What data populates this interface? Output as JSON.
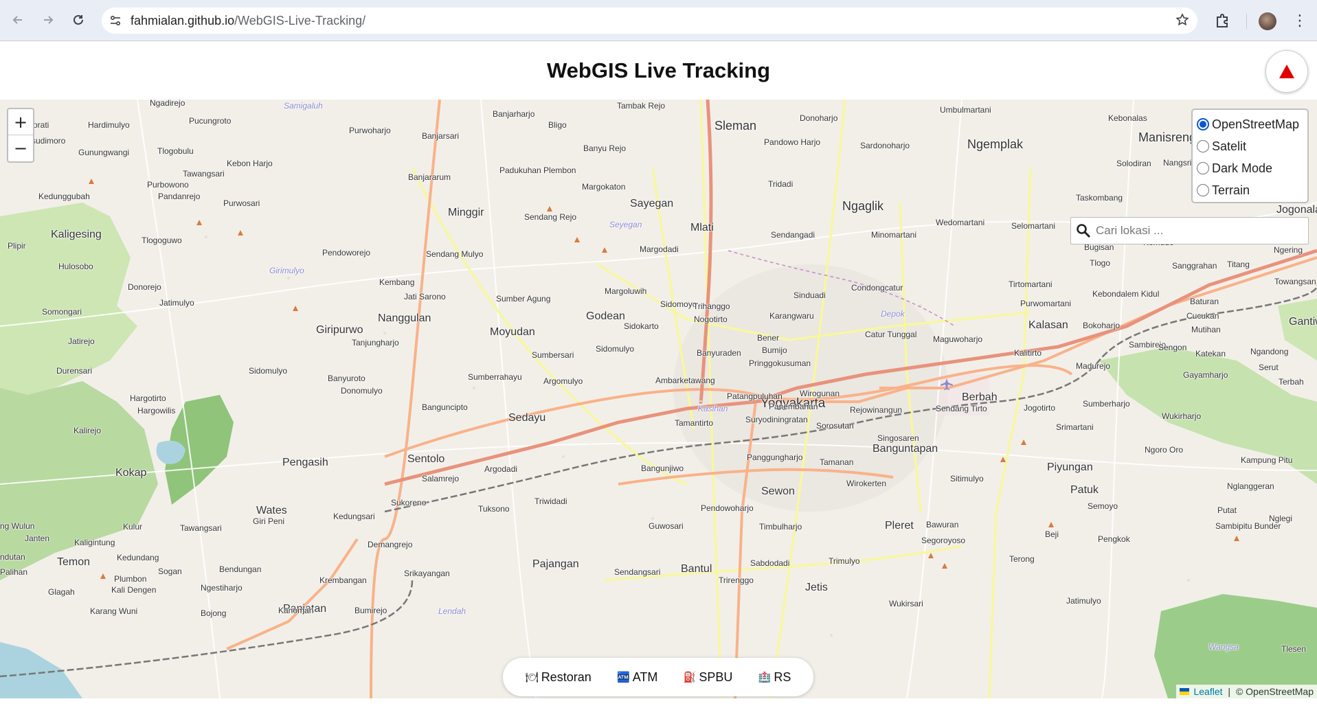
{
  "browser": {
    "url_host": "fahmialan.github.io",
    "url_path": "/WebGIS-Live-Tracking/"
  },
  "header": {
    "title": "WebGIS Live Tracking"
  },
  "map": {
    "zoom_in_label": "+",
    "zoom_out_label": "−",
    "layers": [
      {
        "label": "OpenStreetMap",
        "selected": true
      },
      {
        "label": "Satelit",
        "selected": false
      },
      {
        "label": "Dark Mode",
        "selected": false
      },
      {
        "label": "Terrain",
        "selected": false
      }
    ],
    "search": {
      "placeholder": "Cari lokasi ..."
    },
    "poi_filters": [
      {
        "emoji": "🍽",
        "label": "Restoran"
      },
      {
        "emoji": "🏧",
        "label": "ATM"
      },
      {
        "emoji": "⛽",
        "label": "SPBU"
      },
      {
        "emoji": "🏥",
        "label": "RS"
      }
    ],
    "attribution": {
      "leaflet": "Leaflet",
      "separator": " | ",
      "osm": "© OpenStreetMap"
    },
    "places": {
      "yogyakarta": "Yogyakarta",
      "sleman": "Sleman",
      "ngemplak": "Ngemplak",
      "manisrenggo": "Manisrenggo",
      "sayegan": "Sayegan",
      "mlati": "Mlati",
      "ngaglik": "Ngaglik",
      "minggir": "Minggir",
      "godean": "Godean",
      "moyudan": "Moyudan",
      "nanggulan": "Nanggulan",
      "giripurwo": "Giripurwo",
      "kaligesing": "Kaligesing",
      "kalasan": "Kalasan",
      "gantiwarno": "Gantiwar",
      "berbah": "Berbah",
      "sedayu": "Sedayu",
      "sentolo": "Sentolo",
      "pengasih": "Pengasih",
      "kokap": "Kokap",
      "wates": "Wates",
      "temon": "Temon",
      "panjatan": "Panjatan",
      "pajangan": "Pajangan",
      "bantul": "Bantul",
      "jetis": "Jetis",
      "sewon": "Sewon",
      "banguntapan": "Banguntapan",
      "pleret": "Pleret",
      "piyungan": "Piyungan",
      "patuk": "Patuk",
      "jogonalan": "Jogonalan",
      "donoharjo": "Donoharjo",
      "umbulmartani": "Umbulmartani",
      "kebonalas": "Kebonalas",
      "hardimulyo": "Hardimulyo",
      "pucungroto": "Pucungroto",
      "banjarharjo": "Banjarharjo",
      "tambak_rejo": "Tambak Rejo",
      "samigaluh": "Samigaluh",
      "ngadirejo": "Ngadirejo",
      "purwoharjo": "Purwoharjo",
      "bligo": "Bligo",
      "banyu_rejo": "Banyu Rejo",
      "pandowo_harjo": "Pandowo Harjo",
      "sardonoharjo": "Sardonoharjo",
      "gunungwangi": "Gunungwangi",
      "tlogobulu": "Tlogobulu",
      "kebon_harjo": "Kebon Harjo",
      "banjarsari": "Banjarsari",
      "banjararum": "Banjararum",
      "padukuhan_plembon": "Padukuhan Plembon",
      "margokaton": "Margokaton",
      "tridadi": "Tridadi",
      "kedunggubah": "Kedunggubah",
      "pandanrejo": "Pandanrejo",
      "purwosari": "Purwosari",
      "sendang_rejo": "Sendang Rejo",
      "seyegan": "Seyegan",
      "sendangadi": "Sendangadi",
      "minomartani": "Minomartani",
      "wedomartani": "Wedomartani",
      "selomartani": "Selomartani",
      "taskombang": "Taskombang",
      "tlogoguwo": "Tlogoguwo",
      "pendoworejo": "Pendoworejo",
      "sendang_mulyo": "Sendang Mulyo",
      "margodadi": "Margodadi",
      "kembang": "Kembang",
      "jati_sarono": "Jati Sarono",
      "sumber_agung": "Sumber Agung",
      "margoluwih": "Margoluwih",
      "sinduadi": "Sinduadi",
      "condongcatur": "Condongcatur",
      "purwomartani": "Purwomartani",
      "tirtomartani": "Tirtomartani",
      "kebondalem_kidul": "Kebondalem Kidul",
      "baturan": "Baturan",
      "hulosobo": "Hulosobo",
      "donorejo": "Donorejo",
      "jatimulyo": "Jatimulyo",
      "somongari": "Somongari",
      "sidomoyo": "Sidomoyo",
      "trihanggo": "Trihanggo",
      "karangwaru": "Karangwaru",
      "depok": "Depok",
      "sidokarto": "Sidokarto",
      "nogotirto": "Nogotirto",
      "bener": "Bener",
      "catur_tunggal": "Catur Tunggal",
      "maguwoharjo": "Maguwoharjo",
      "bokoharjo": "Bokoharjo",
      "sambirejo": "Sambirejo",
      "tanjungharjo": "Tanjungharjo",
      "sumbersari": "Sumbersari",
      "sidomulyo": "Sidomulyo",
      "banyuraden": "Banyuraden",
      "bumijo": "Bumijo",
      "pringgokusuman": "Pringgokusuman",
      "kalitirto": "Kalitirto",
      "madurejo": "Madurejo",
      "gayamharjo": "Gayamharjo",
      "durensari": "Durensari",
      "banyuroto": "Banyuroto",
      "donomulyo": "Donomulyo",
      "sumberrahayu": "Sumberrahayu",
      "argomulyo": "Argomulyo",
      "ambarketawang": "Ambarketawang",
      "patangpuluhan": "Patangpuluhan",
      "wirogunan": "Wirogunan",
      "hargotirto": "Hargotirto",
      "hargowilis": "Hargowilis",
      "bangunjipto": "Banguncipto",
      "kasihan": "Kasihan",
      "panembahan": "Panembahan",
      "rejowinangun": "Rejowinangun",
      "sendang_tirto": "Sendang Tirto",
      "jogotirto": "Jogotirto",
      "sumberharjo": "Sumberharjo",
      "wukirharjo": "Wukirharjo",
      "kalirejo": "Kalirejo",
      "tamantirto": "Tamantirto",
      "suryodiningratan": "Suryodiningratan",
      "sorosutan": "Sorosutan",
      "srimartani": "Srimartani",
      "singosaren": "Singosaren",
      "argodadi": "Argodadi",
      "salamrejo": "Salamrejo",
      "bangunjiwo": "Bangunjiwo",
      "panggungharjo": "Panggungharjo",
      "tamanan": "Tamanan",
      "sitimulyo": "Sitimulyo",
      "ngoro_oro": "Ngoro Oro",
      "kampung_pitu": "Kampung Pitu",
      "triwidadi": "Triwidadi",
      "sukoreno": "Sukoreno",
      "tuksono": "Tuksono",
      "pendowoharjo": "Pendowoharjo",
      "wirokerten": "Wirokerten",
      "nglanggeran": "Nglanggeran",
      "ngwulun": "ng Wulun",
      "janten": "Janten",
      "kulur": "Kulur",
      "tawangsari": "Tawangsari",
      "giri_peni": "Giri Peni",
      "kedungsari": "Kedungsari",
      "guwosari": "Guwosari",
      "timbulharjo": "Timbulharjo",
      "bawuran": "Bawuran",
      "semoyo": "Semoyo",
      "putat": "Putat",
      "kaligintung": "Kaligintung",
      "demangrejo": "Demangrejo",
      "segoroyoso": "Segoroyoso",
      "beji": "Beji",
      "pengkok": "Pengkok",
      "sambipitu_bunder": "Sambipitu Bunder",
      "ngelegi": "Nglegi",
      "kedundang": "Kedundang",
      "sabdodadi": "Sabdodadi",
      "trimulyo": "Trimulyo",
      "terong": "Terong",
      "sogan": "Sogan",
      "bendungan": "Bendungan",
      "srikayangan": "Srikayangan",
      "sendangsari": "Sendangsari",
      "plumbon": "Plumbon",
      "kali_dengen": "Kali Dengen",
      "ngestiharjo": "Ngestiharjo",
      "krembangan": "Krembangan",
      "trirenggo": "Trirenggo",
      "glagah": "Glagah",
      "karang_wuni": "Karang Wuni",
      "bojong": "Bojong",
      "kanoman": "Kanoman",
      "bumirejo": "Bumirejo",
      "lendah": "Lendah",
      "wukirsari": "Wukirsari",
      "jatimulyo2": "Jatimulyo",
      "tlogo": "Tlogo",
      "kemudo": "Kemudo",
      "bugisan": "Bugisan",
      "sanggrahan": "Sanggrahan",
      "titang": "Titang",
      "ngering": "Ngering",
      "towangsan": "Towangsan",
      "cucukan": "Cucukan",
      "mutihan": "Mutihan",
      "sengon": "Sengon",
      "katekan": "Katekan",
      "ngandong": "Ngandong",
      "serut": "Serut",
      "terbah": "Terbah",
      "nangsri": "Nangsri",
      "solodiran": "Solodiran",
      "wangsa": "Wangsa",
      "tlesen": "Tlesen",
      "jatirejo": "Jatirejo",
      "girimulyo": "Girimulyo",
      "plipir": "Plipir",
      "tawangsari2": "Tawangsari",
      "purbowono": "Purbowono",
      "sidomulyo2": "Sidomulyo",
      "orati": "orati",
      "sudimoro": "sudimoro",
      "palihan": "Palihan",
      "ndutan": "ndutan"
    }
  }
}
